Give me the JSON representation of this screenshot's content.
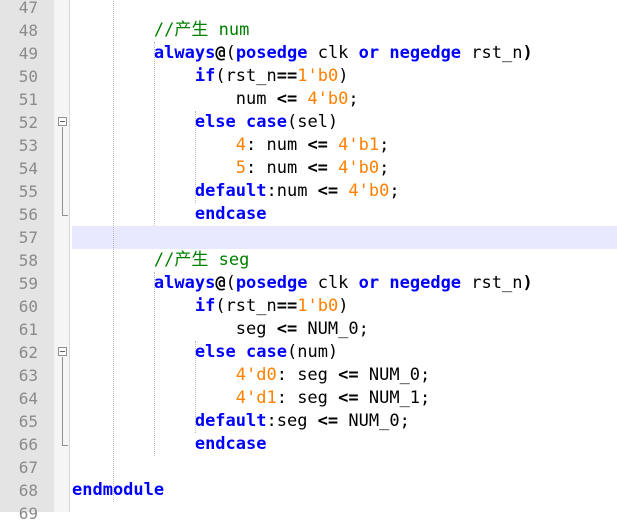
{
  "editor": {
    "lines": [
      {
        "n": "47",
        "tokens": []
      },
      {
        "n": "48",
        "tokens": [
          {
            "t": "        "
          },
          {
            "t": "//产生 num",
            "c": "cm"
          }
        ]
      },
      {
        "n": "49",
        "tokens": [
          {
            "t": "        "
          },
          {
            "t": "always",
            "c": "kw"
          },
          {
            "t": "@",
            "c": "op"
          },
          {
            "t": "("
          },
          {
            "t": "posedge",
            "c": "kw"
          },
          {
            "t": " clk "
          },
          {
            "t": "or",
            "c": "kw"
          },
          {
            "t": " "
          },
          {
            "t": "negedge",
            "c": "kw"
          },
          {
            "t": " rst_n"
          },
          {
            "t": ")",
            "c": "op"
          }
        ]
      },
      {
        "n": "50",
        "tokens": [
          {
            "t": "            "
          },
          {
            "t": "if",
            "c": "kw"
          },
          {
            "t": "("
          },
          {
            "t": "rst_n"
          },
          {
            "t": "==",
            "c": "op"
          },
          {
            "t": "1",
            "c": "num"
          },
          {
            "t": "'b0",
            "c": "num"
          },
          {
            "t": ")"
          }
        ]
      },
      {
        "n": "51",
        "tokens": [
          {
            "t": "                num "
          },
          {
            "t": "<=",
            "c": "op"
          },
          {
            "t": " "
          },
          {
            "t": "4'b0",
            "c": "num"
          },
          {
            "t": ";"
          }
        ]
      },
      {
        "n": "52",
        "tokens": [
          {
            "t": "            "
          },
          {
            "t": "else",
            "c": "kw"
          },
          {
            "t": " "
          },
          {
            "t": "case",
            "c": "kw"
          },
          {
            "t": "(sel)"
          }
        ],
        "fold": "start"
      },
      {
        "n": "53",
        "tokens": [
          {
            "t": "                "
          },
          {
            "t": "4",
            "c": "num"
          },
          {
            "t": ": num "
          },
          {
            "t": "<=",
            "c": "op"
          },
          {
            "t": " "
          },
          {
            "t": "4'b1",
            "c": "num"
          },
          {
            "t": ";"
          }
        ]
      },
      {
        "n": "54",
        "tokens": [
          {
            "t": "                "
          },
          {
            "t": "5",
            "c": "num"
          },
          {
            "t": ": num "
          },
          {
            "t": "<=",
            "c": "op"
          },
          {
            "t": " "
          },
          {
            "t": "4'b0",
            "c": "num"
          },
          {
            "t": ";"
          }
        ]
      },
      {
        "n": "55",
        "tokens": [
          {
            "t": "            "
          },
          {
            "t": "default",
            "c": "kw"
          },
          {
            "t": ":num "
          },
          {
            "t": "<=",
            "c": "op"
          },
          {
            "t": " "
          },
          {
            "t": "4'b0",
            "c": "num"
          },
          {
            "t": ";"
          }
        ]
      },
      {
        "n": "56",
        "tokens": [
          {
            "t": "            "
          },
          {
            "t": "endcase",
            "c": "kw"
          }
        ],
        "fold": "end"
      },
      {
        "n": "57",
        "tokens": [],
        "current": true
      },
      {
        "n": "58",
        "tokens": [
          {
            "t": "        "
          },
          {
            "t": "//产生 seg",
            "c": "cm"
          }
        ]
      },
      {
        "n": "59",
        "tokens": [
          {
            "t": "        "
          },
          {
            "t": "always",
            "c": "kw"
          },
          {
            "t": "@",
            "c": "op"
          },
          {
            "t": "("
          },
          {
            "t": "posedge",
            "c": "kw"
          },
          {
            "t": " clk "
          },
          {
            "t": "or",
            "c": "kw"
          },
          {
            "t": " "
          },
          {
            "t": "negedge",
            "c": "kw"
          },
          {
            "t": " rst_n"
          },
          {
            "t": ")",
            "c": "op"
          }
        ]
      },
      {
        "n": "60",
        "tokens": [
          {
            "t": "            "
          },
          {
            "t": "if",
            "c": "kw"
          },
          {
            "t": "("
          },
          {
            "t": "rst_n"
          },
          {
            "t": "==",
            "c": "op"
          },
          {
            "t": "1",
            "c": "num"
          },
          {
            "t": "'b0",
            "c": "num"
          },
          {
            "t": ")"
          }
        ]
      },
      {
        "n": "61",
        "tokens": [
          {
            "t": "                seg "
          },
          {
            "t": "<=",
            "c": "op"
          },
          {
            "t": " NUM_0;"
          }
        ]
      },
      {
        "n": "62",
        "tokens": [
          {
            "t": "            "
          },
          {
            "t": "else",
            "c": "kw"
          },
          {
            "t": " "
          },
          {
            "t": "case",
            "c": "kw"
          },
          {
            "t": "(num)"
          }
        ],
        "fold": "start"
      },
      {
        "n": "63",
        "tokens": [
          {
            "t": "                "
          },
          {
            "t": "4'd0",
            "c": "num"
          },
          {
            "t": ": seg "
          },
          {
            "t": "<=",
            "c": "op"
          },
          {
            "t": " NUM_0;"
          }
        ]
      },
      {
        "n": "64",
        "tokens": [
          {
            "t": "                "
          },
          {
            "t": "4'd1",
            "c": "num"
          },
          {
            "t": ": seg "
          },
          {
            "t": "<=",
            "c": "op"
          },
          {
            "t": " NUM_1;"
          }
        ]
      },
      {
        "n": "65",
        "tokens": [
          {
            "t": "            "
          },
          {
            "t": "default",
            "c": "kw"
          },
          {
            "t": ":seg "
          },
          {
            "t": "<=",
            "c": "op"
          },
          {
            "t": " NUM_0;"
          }
        ]
      },
      {
        "n": "66",
        "tokens": [
          {
            "t": "            "
          },
          {
            "t": "endcase",
            "c": "kw"
          }
        ],
        "fold": "end"
      },
      {
        "n": "67",
        "tokens": []
      },
      {
        "n": "68",
        "tokens": [
          {
            "t": "endmodule",
            "c": "kw"
          }
        ]
      },
      {
        "n": "69",
        "tokens": []
      }
    ]
  },
  "colors": {
    "keyword": "#0000ff",
    "number": "#ff8000",
    "comment": "#008000",
    "current_line": "#e8e8ff",
    "gutter": "#e4e4e4"
  }
}
